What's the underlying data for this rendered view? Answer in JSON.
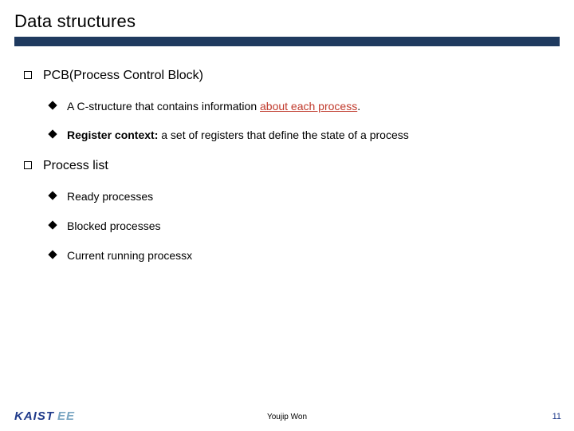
{
  "title": "Data structures",
  "sec1": {
    "heading": "PCB(Process Control Block)",
    "item1_pre": "A C-structure that contains information ",
    "item1_hl": "about each process",
    "item1_post": ".",
    "item2_pre": "Register context:",
    "item2_post": "  a set of registers that define the state of a process"
  },
  "sec2": {
    "heading": "Process list",
    "item1": "Ready processes",
    "item2": "Blocked processes",
    "item3": "Current running processx"
  },
  "footer": {
    "logo_main": "KAIST",
    "logo_sub": "EE",
    "author": "Youjip Won",
    "page": "11"
  }
}
